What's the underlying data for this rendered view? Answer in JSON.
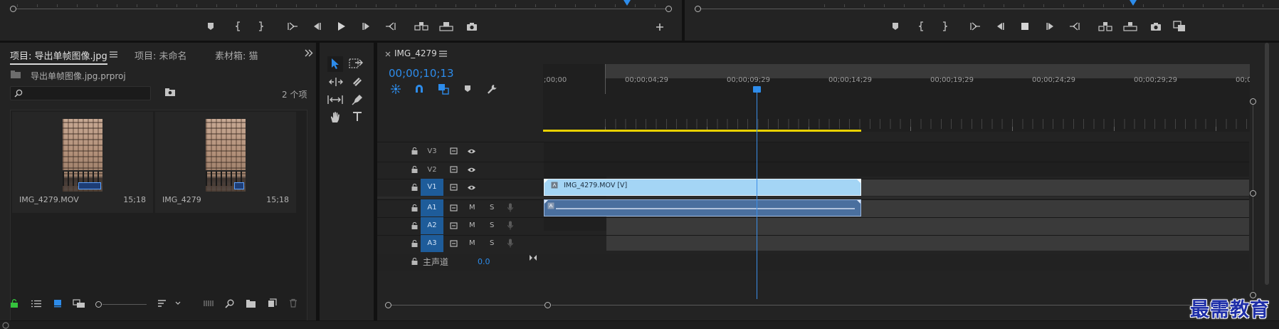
{
  "source_monitor": {
    "transport": [
      "marker",
      "mark-in",
      "mark-out",
      "go-to-in",
      "step-back",
      "play",
      "step-forward",
      "go-to-out",
      "insert",
      "overwrite",
      "export-frame",
      "add"
    ]
  },
  "program_monitor": {
    "transport": [
      "marker",
      "mark-in",
      "mark-out",
      "go-to-in",
      "step-back",
      "stop",
      "step-forward",
      "go-to-out",
      "lift",
      "extract",
      "export-frame",
      "comparison-view"
    ]
  },
  "project_panel": {
    "tabs": [
      {
        "label": "项目: 导出单帧图像.jpg",
        "active": true
      },
      {
        "label": "项目: 未命名",
        "active": false
      },
      {
        "label": "素材箱: 猫",
        "active": false
      }
    ],
    "project_file": "导出单帧图像.jpg.prproj",
    "search": {
      "value": "",
      "placeholder": ""
    },
    "item_count": "2 个项",
    "items": [
      {
        "name": "IMG_4279.MOV",
        "duration": "15;18"
      },
      {
        "name": "IMG_4279",
        "duration": "15;18"
      }
    ]
  },
  "timeline": {
    "sequence_tab": "IMG_4279",
    "timecode": "00;00;10;13",
    "ruler": [
      ";00;00",
      "00;00;04;29",
      "00;00;09;29",
      "00;00;14;29",
      "00;00;19;29",
      "00;00;24;29",
      "00;00;29;29",
      "00;0("
    ],
    "tracks": [
      {
        "name": "V3",
        "kind": "video",
        "targeted": false
      },
      {
        "name": "V2",
        "kind": "video",
        "targeted": false
      },
      {
        "name": "V1",
        "kind": "video",
        "targeted": true
      },
      {
        "name": "A1",
        "kind": "audio",
        "targeted": true
      },
      {
        "name": "A2",
        "kind": "audio",
        "targeted": true
      },
      {
        "name": "A3",
        "kind": "audio",
        "targeted": true
      }
    ],
    "mute_label": "M",
    "solo_label": "S",
    "master": {
      "label": "主声道",
      "value": "0.0"
    },
    "video_clip": {
      "label": "IMG_4279.MOV [V]"
    }
  },
  "watermark": "最需教育",
  "colors": {
    "accent_blue": "#2d8ceb",
    "track_target_blue": "#1e5c9a",
    "video_clip": "#a4d5f5",
    "audio_clip": "#4a6f9e",
    "work_area_yellow": "#e9d100"
  }
}
